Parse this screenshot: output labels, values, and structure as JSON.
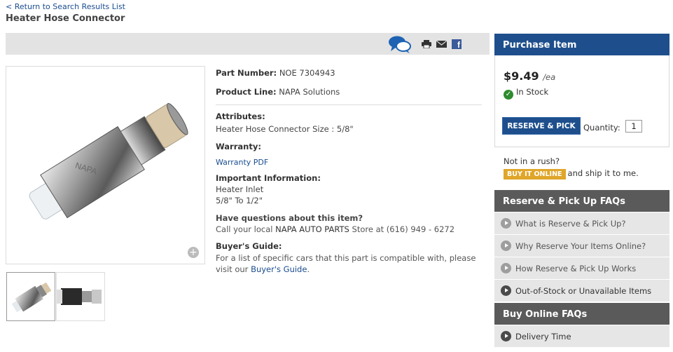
{
  "breadcrumb": {
    "back_link": "< Return to Search Results List"
  },
  "page": {
    "title": "Heater Hose Connector"
  },
  "toolbar": {
    "icons": [
      "chat-icon",
      "print-icon",
      "mail-icon",
      "facebook-icon"
    ],
    "facebook_glyph": "f"
  },
  "product": {
    "part_number_label": "Part Number:",
    "part_number": "NOE 7304943",
    "product_line_label": "Product Line:",
    "product_line": "NAPA Solutions",
    "attributes_label": "Attributes:",
    "attributes_value": "Heater Hose Connector Size : 5/8\"",
    "warranty_label": "Warranty:",
    "warranty_link": "Warranty PDF",
    "important_label": "Important Information:",
    "important_lines": [
      "Heater Inlet",
      "5/8\" To 1/2\""
    ],
    "questions_label": "Have questions about this item?",
    "questions_prefix": "Call your local ",
    "questions_store": "NAPA AUTO PARTS",
    "questions_suffix": " Store at (616) 949 - 6272",
    "buyers_guide_label": "Buyer's Guide:",
    "buyers_guide_text1": "For a list of specific cars that this part is compatible with, please",
    "buyers_guide_text2_prefix": "visit our ",
    "buyers_guide_link": "Buyer's Guide",
    "buyers_guide_text2_suffix": ".",
    "image_brand_text": "NAPA"
  },
  "purchase": {
    "header": "Purchase Item",
    "price": "$9.49",
    "unit": "/ea",
    "stock_status": "In Stock",
    "reserve_button": "RESERVE & PICK UP",
    "quantity_label": "Quantity:",
    "quantity_value": "1",
    "rush_text": "Not in a rush?",
    "buy_online_button": "BUY IT ONLINE",
    "buy_online_suffix": "and ship it to me.",
    "accent_color": "#1e4f8c",
    "buy_color": "#e0a62a"
  },
  "faq": {
    "reserve_header": "Reserve & Pick Up FAQs",
    "reserve_items": [
      "What is Reserve & Pick Up?",
      "Why Reserve Your Items Online?",
      "How Reserve & Pick Up Works",
      "Out-of-Stock or Unavailable Items"
    ],
    "online_header": "Buy Online FAQs",
    "online_items": [
      "Delivery Time"
    ]
  }
}
